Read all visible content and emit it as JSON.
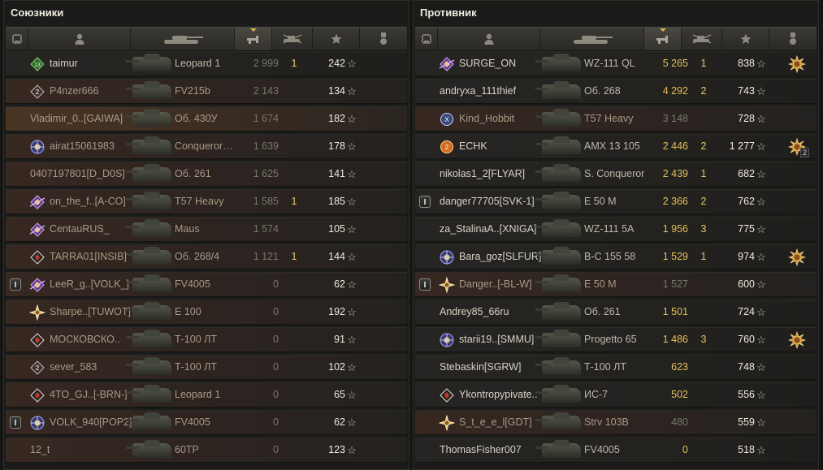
{
  "allies": {
    "title": "Союзники",
    "rows": [
      {
        "name": "taimur",
        "vehicle": "Leopard 1",
        "xp": "2 999",
        "kills": "1",
        "points": "242",
        "badge": "badge-13",
        "state": "alive",
        "xpStyle": "dim",
        "platoon": false,
        "medal": false
      },
      {
        "name": "P4nzer666",
        "vehicle": "FV215b",
        "xp": "2 143",
        "kills": "",
        "points": "134",
        "badge": "badge-2",
        "state": "dead",
        "xpStyle": "dim",
        "platoon": false,
        "medal": false
      },
      {
        "name": "Vladimir_0..[GAIWA]",
        "vehicle": "Об. 430У",
        "xp": "1 674",
        "kills": "",
        "points": "182",
        "badge": "none",
        "state": "tk",
        "xpStyle": "dim",
        "platoon": false,
        "medal": false
      },
      {
        "name": "airat15061983",
        "vehicle": "Conqueror…",
        "xp": "1 639",
        "kills": "",
        "points": "178",
        "badge": "badge-blue",
        "state": "dead",
        "xpStyle": "dim",
        "platoon": false,
        "medal": false
      },
      {
        "name": "0407197801[D_D0S]",
        "vehicle": "Об. 261",
        "xp": "1 625",
        "kills": "",
        "points": "141",
        "badge": "none",
        "state": "dead",
        "xpStyle": "dim",
        "platoon": false,
        "medal": false
      },
      {
        "name": "on_the_f..[A-CO]",
        "vehicle": "T57 Heavy",
        "xp": "1 585",
        "kills": "1",
        "points": "185",
        "badge": "badge-purple",
        "state": "dead",
        "xpStyle": "dim",
        "platoon": false,
        "medal": false
      },
      {
        "name": "CentauRUS_",
        "vehicle": "Maus",
        "xp": "1 574",
        "kills": "",
        "points": "105",
        "badge": "badge-purple",
        "state": "dead",
        "xpStyle": "dim",
        "platoon": false,
        "medal": false
      },
      {
        "name": "TARRA01[INSIB]",
        "vehicle": "Об. 268/4",
        "xp": "1 121",
        "kills": "1",
        "points": "144",
        "badge": "badge-red",
        "state": "dead",
        "xpStyle": "dim",
        "platoon": false,
        "medal": false
      },
      {
        "name": "LeeR_g..[VOLK_]",
        "vehicle": "FV4005",
        "xp": "0",
        "kills": "",
        "points": "62",
        "badge": "badge-purple",
        "state": "dead",
        "xpStyle": "dim",
        "platoon": true,
        "medal": false
      },
      {
        "name": "Sharpe..[TUWOT]",
        "vehicle": "E 100",
        "xp": "0",
        "kills": "",
        "points": "192",
        "badge": "badge-gold",
        "state": "dead",
        "xpStyle": "dim",
        "platoon": false,
        "medal": false
      },
      {
        "name": "МОСКОВСКО..",
        "vehicle": "Т-100 ЛТ",
        "xp": "0",
        "kills": "",
        "points": "91",
        "badge": "badge-red",
        "state": "dead",
        "xpStyle": "dim",
        "platoon": false,
        "medal": false
      },
      {
        "name": "sever_583",
        "vehicle": "Т-100 ЛТ",
        "xp": "0",
        "kills": "",
        "points": "102",
        "badge": "badge-2",
        "state": "dead",
        "xpStyle": "dim",
        "platoon": false,
        "medal": false
      },
      {
        "name": "4TO_GJ..[-BRN-]",
        "vehicle": "Leopard 1",
        "xp": "0",
        "kills": "",
        "points": "65",
        "badge": "badge-red",
        "state": "dead",
        "xpStyle": "dim",
        "platoon": false,
        "medal": false
      },
      {
        "name": "VOLK_940[POP2]",
        "vehicle": "FV4005",
        "xp": "0",
        "kills": "",
        "points": "62",
        "badge": "badge-blue",
        "state": "dead",
        "xpStyle": "dim",
        "platoon": true,
        "medal": false
      },
      {
        "name": "12_t",
        "vehicle": "60TP",
        "xp": "0",
        "kills": "",
        "points": "123",
        "badge": "none",
        "state": "dead",
        "xpStyle": "dim",
        "platoon": false,
        "medal": false
      }
    ]
  },
  "enemies": {
    "title": "Противник",
    "rows": [
      {
        "name": "SURGE_ON",
        "vehicle": "WZ-111 QL",
        "xp": "5 265",
        "kills": "1",
        "points": "838",
        "badge": "badge-purple",
        "state": "alive",
        "xpStyle": "gold",
        "platoon": false,
        "medal": true,
        "medalCount": ""
      },
      {
        "name": "andryxa_111thief",
        "vehicle": "Об. 268",
        "xp": "4 292",
        "kills": "2",
        "points": "743",
        "badge": "none",
        "state": "alive",
        "xpStyle": "gold",
        "platoon": false,
        "medal": false
      },
      {
        "name": "Kind_Hobbit",
        "vehicle": "T57 Heavy",
        "xp": "3 148",
        "kills": "",
        "points": "728",
        "badge": "badge-x",
        "state": "dead",
        "xpStyle": "dim",
        "platoon": false,
        "medal": false
      },
      {
        "name": "ECHK",
        "vehicle": "AMX 13 105",
        "xp": "2 446",
        "kills": "2",
        "points": "1 277",
        "badge": "badge-orange",
        "state": "alive",
        "xpStyle": "gold",
        "platoon": false,
        "medal": true,
        "medalCount": "2"
      },
      {
        "name": "nikolas1_2[FLYAR]",
        "vehicle": "S. Conqueror",
        "xp": "2 439",
        "kills": "1",
        "points": "682",
        "badge": "none",
        "state": "alive",
        "xpStyle": "gold",
        "platoon": false,
        "medal": false
      },
      {
        "name": "danger77705[SVK-1]",
        "vehicle": "E 50 M",
        "xp": "2 366",
        "kills": "2",
        "points": "762",
        "badge": "none",
        "state": "alive",
        "xpStyle": "gold",
        "platoon": true,
        "medal": false
      },
      {
        "name": "za_StalinaA..[XNIGA]",
        "vehicle": "WZ-111 5A",
        "xp": "1 956",
        "kills": "3",
        "points": "775",
        "badge": "none",
        "state": "alive",
        "xpStyle": "gold",
        "platoon": false,
        "medal": false
      },
      {
        "name": "Bara_goz[SLFUR]",
        "vehicle": "В-С 155 58",
        "xp": "1 529",
        "kills": "1",
        "points": "974",
        "badge": "badge-blue",
        "state": "alive",
        "xpStyle": "gold",
        "platoon": false,
        "medal": true,
        "medalCount": ""
      },
      {
        "name": "Danger..[-BL-W]",
        "vehicle": "E 50 M",
        "xp": "1 527",
        "kills": "",
        "points": "600",
        "badge": "badge-gold",
        "state": "dead",
        "xpStyle": "dim",
        "platoon": true,
        "medal": false
      },
      {
        "name": "Andrey85_66ru",
        "vehicle": "Об. 261",
        "xp": "1 501",
        "kills": "",
        "points": "724",
        "badge": "none",
        "state": "alive",
        "xpStyle": "gold",
        "platoon": false,
        "medal": false
      },
      {
        "name": "starii19..[SMMU]",
        "vehicle": "Progetto 65",
        "xp": "1 486",
        "kills": "3",
        "points": "760",
        "badge": "badge-blue",
        "state": "alive",
        "xpStyle": "gold",
        "platoon": false,
        "medal": true,
        "medalCount": ""
      },
      {
        "name": "Stebaskin[SGRW]",
        "vehicle": "Т-100 ЛТ",
        "xp": "623",
        "kills": "",
        "points": "748",
        "badge": "none",
        "state": "alive",
        "xpStyle": "gold",
        "platoon": false,
        "medal": false
      },
      {
        "name": "Ykontropypivate..",
        "vehicle": "ИС-7",
        "xp": "502",
        "kills": "",
        "points": "556",
        "badge": "badge-red",
        "state": "alive",
        "xpStyle": "gold",
        "platoon": false,
        "medal": false
      },
      {
        "name": "S_t_e_e_l[GDT]",
        "vehicle": "Strv 103B",
        "xp": "480",
        "kills": "",
        "points": "559",
        "badge": "badge-gold",
        "state": "dead",
        "xpStyle": "dim",
        "platoon": false,
        "medal": false
      },
      {
        "name": "ThomasFisher007",
        "vehicle": "FV4005",
        "xp": "0",
        "kills": "",
        "points": "518",
        "badge": "none",
        "state": "alive",
        "xpStyle": "gold",
        "platoon": false,
        "medal": false
      }
    ]
  },
  "colors": {
    "gold": "#e6bf5a",
    "text": "#cfcabd",
    "dead": "#372821"
  }
}
